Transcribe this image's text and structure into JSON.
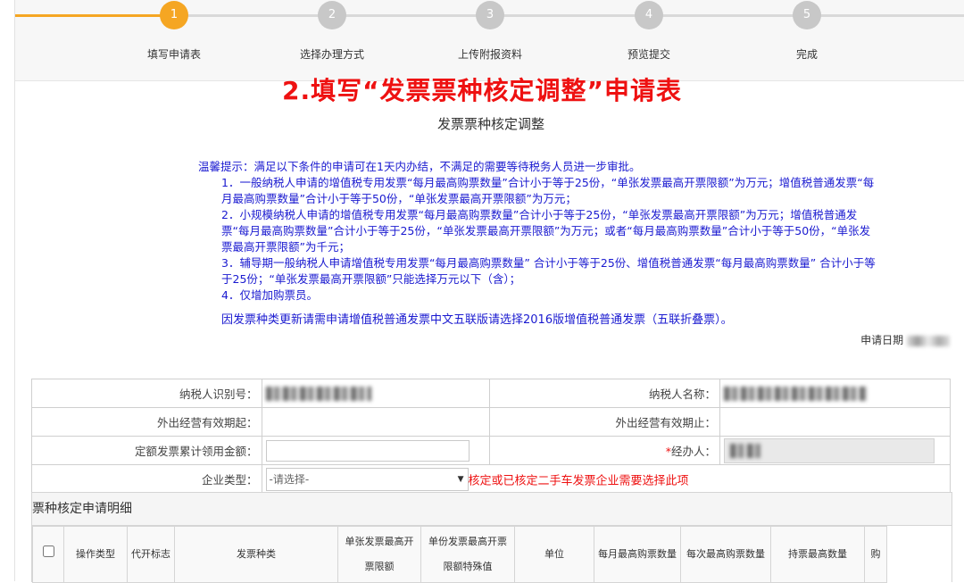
{
  "steps": [
    {
      "num": "1",
      "label": "填写申请表"
    },
    {
      "num": "2",
      "label": "选择办理方式"
    },
    {
      "num": "3",
      "label": "上传附报资料"
    },
    {
      "num": "4",
      "label": "预览提交"
    },
    {
      "num": "5",
      "label": "完成"
    }
  ],
  "active_step": 1,
  "colors": {
    "accent": "#f5a623",
    "title_red": "#ee1111",
    "notice_blue": "#1a1ad0"
  },
  "page": {
    "big_title": "2.填写“发票票种核定调整”申请表",
    "sub_title": "发票票种核定调整"
  },
  "notice": {
    "intro": "温馨提示：满足以下条件的申请可在1天内办结，不满足的需要等待税务人员进一步审批。",
    "items": [
      "1．一般纳税人申请的增值税专用发票“每月最高购票数量”合计小于等于25份，“单张发票最高开票限额”为万元；增值税普通发票“每月最高购票数量”合计小于等于50份，“单张发票最高开票限额”为万元；",
      "2．小规模纳税人申请的增值税专用发票“每月最高购票数量”合计小于等于25份，“单张发票最高开票限额”为万元；增值税普通发票“每月最高购票数量”合计小于等于25份，“单张发票最高开票限额”为万元；或者“每月最高购票数量”合计小于等于50份，“单张发票最高开票限额”为千元；",
      "3．辅导期一般纳税人申请增值税专用发票“每月最高购票数量” 合计小于等于25份、增值税普通发票“每月最高购票数量” 合计小于等于25份；“单张发票最高开票限额”只能选择万元以下（含）；",
      "4．仅增加购票员。"
    ],
    "note2": "因发票种类更新请需申请增值税普通发票中文五联版请选择2016版增值税普通发票（五联折叠票）。"
  },
  "apply_date_label": "申请日期",
  "form": {
    "taxpayer_id_label": "纳税人识别号：",
    "taxpayer_name_label": "纳税人名称：",
    "valid_from_label": "外出经营有效期起：",
    "valid_to_label": "外出经营有效期止：",
    "amount_label": "定额发票累计领用金额：",
    "agent_required": "*",
    "agent_label": "经办人：",
    "company_type_label": "企业类型：",
    "company_type_value": "-请选择-",
    "company_type_hint": "核定或已核定二手车发票企业需要选择此项"
  },
  "detail": {
    "title": "票种核定申请明细",
    "columns": [
      "操作类型",
      "代开标志",
      "发票种类",
      "单张发票最高开票限额",
      "单份发票最高开票限额特殊值",
      "单位",
      "每月最高购票数量",
      "每次最高购票数量",
      "持票最高数量",
      "购"
    ]
  }
}
